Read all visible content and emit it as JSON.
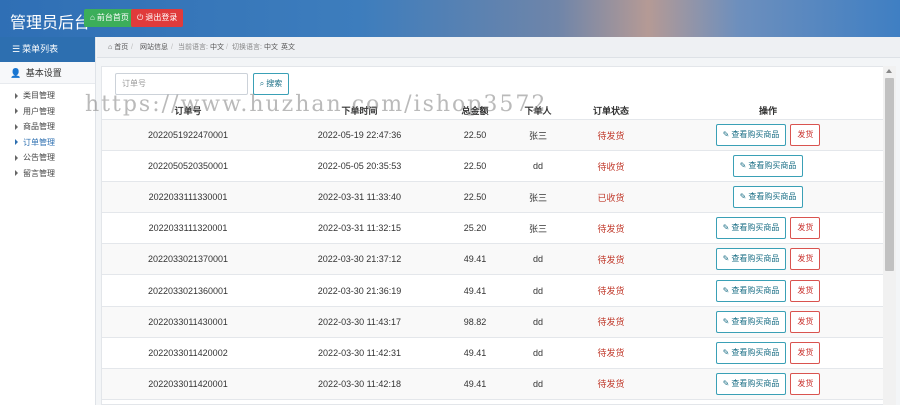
{
  "header": {
    "title": "管理员后台",
    "home_button": "前台首页",
    "logout_button": "退出登录"
  },
  "sidebar": {
    "heading": "菜单列表",
    "group": "基本设置",
    "items": [
      {
        "label": "类目管理",
        "active": false
      },
      {
        "label": "用户管理",
        "active": false
      },
      {
        "label": "商品管理",
        "active": false
      },
      {
        "label": "订单管理",
        "active": true
      },
      {
        "label": "公告管理",
        "active": false
      },
      {
        "label": "留言管理",
        "active": false
      }
    ]
  },
  "breadcrumb": {
    "home": "首页",
    "site_info": "网站信息",
    "current_lang_label": "当前语言:",
    "current_lang": "中文",
    "switch_lang_label": "切换语言:",
    "lang_zh": "中文",
    "lang_en": "英文"
  },
  "search": {
    "placeholder": "订单号",
    "button": "搜索"
  },
  "table": {
    "headers": {
      "order_no": "订单号",
      "time": "下单时间",
      "amount": "总金额",
      "user": "下单人",
      "status": "订单状态",
      "ops": "操作"
    },
    "view_label": "查看购买商品",
    "ship_label": "发货",
    "rows": [
      {
        "order_no": "2022051922470001",
        "time": "2022-05-19 22:47:36",
        "amount": "22.50",
        "user": "张三",
        "status": "待发货",
        "ship": true
      },
      {
        "order_no": "2022050520350001",
        "time": "2022-05-05 20:35:53",
        "amount": "22.50",
        "user": "dd",
        "status": "待收货",
        "ship": false
      },
      {
        "order_no": "2022033111330001",
        "time": "2022-03-31 11:33:40",
        "amount": "22.50",
        "user": "张三",
        "status": "已收货",
        "ship": false
      },
      {
        "order_no": "2022033111320001",
        "time": "2022-03-31 11:32:15",
        "amount": "25.20",
        "user": "张三",
        "status": "待发货",
        "ship": true
      },
      {
        "order_no": "2022033021370001",
        "time": "2022-03-30 21:37:12",
        "amount": "49.41",
        "user": "dd",
        "status": "待发货",
        "ship": true
      },
      {
        "order_no": "2022033021360001",
        "time": "2022-03-30 21:36:19",
        "amount": "49.41",
        "user": "dd",
        "status": "待发货",
        "ship": true
      },
      {
        "order_no": "2022033011430001",
        "time": "2022-03-30 11:43:17",
        "amount": "98.82",
        "user": "dd",
        "status": "待发货",
        "ship": true
      },
      {
        "order_no": "2022033011420002",
        "time": "2022-03-30 11:42:31",
        "amount": "49.41",
        "user": "dd",
        "status": "待发货",
        "ship": true
      },
      {
        "order_no": "2022033011420001",
        "time": "2022-03-30 11:42:18",
        "amount": "49.41",
        "user": "dd",
        "status": "待发货",
        "ship": true
      }
    ]
  },
  "watermark": "https://www.huzhan.com/ishop3572",
  "colors": {
    "primary": "#2d6fb0",
    "success": "#3cae5a",
    "danger": "#e03b3b",
    "status_red": "#c0392b",
    "info": "#3aa0b6"
  }
}
